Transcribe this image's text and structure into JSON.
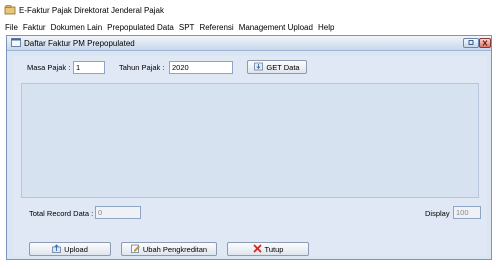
{
  "app": {
    "title": "E-Faktur Pajak Direktorat Jenderal Pajak"
  },
  "menubar": {
    "items": [
      {
        "label": "File"
      },
      {
        "label": "Faktur"
      },
      {
        "label": "Dokumen Lain"
      },
      {
        "label": "Prepopulated Data"
      },
      {
        "label": "SPT"
      },
      {
        "label": "Referensi"
      },
      {
        "label": "Management Upload"
      },
      {
        "label": "Help"
      }
    ]
  },
  "dialog": {
    "title": "Daftar Faktur PM Prepopulated",
    "masa_pajak_label": "Masa Pajak :",
    "masa_pajak_value": "1",
    "tahun_pajak_label": "Tahun Pajak :",
    "tahun_pajak_value": "2020",
    "get_data_label": "GET Data",
    "total_record_label": "Total Record Data :",
    "total_record_value": "0",
    "display_label": "Display",
    "display_value": "100",
    "upload_label": "Upload",
    "ubah_label": "Ubah Pengkreditan",
    "tutup_label": "Tutup"
  },
  "colors": {
    "window_bg": "#dbe6f3",
    "border": "#7a96bd",
    "close_icon": "#d02b1f"
  }
}
